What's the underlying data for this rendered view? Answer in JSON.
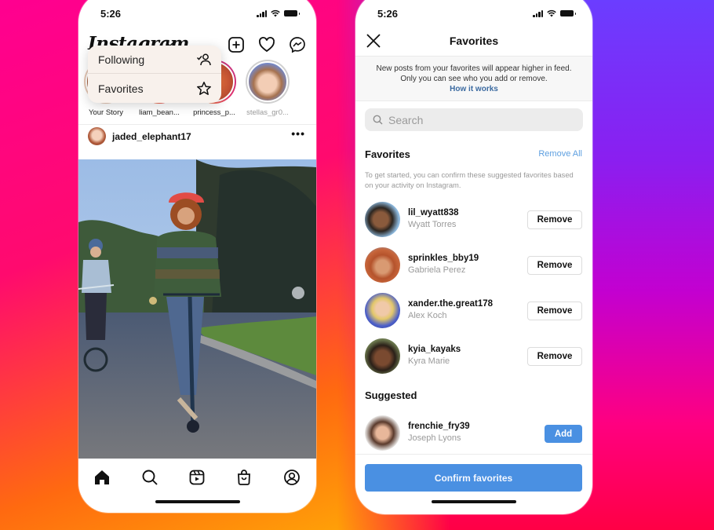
{
  "colors": {
    "accent_blue": "#4a90e2",
    "link_blue": "#3b6aa0",
    "remove_all_blue": "#5d9fe0",
    "muted_text": "#9a9a9a"
  },
  "left_phone": {
    "status_bar": {
      "time": "5:26",
      "icons": [
        "signal-icon",
        "wifi-icon",
        "battery-icon"
      ]
    },
    "header": {
      "logo": "Instagram",
      "logo_chevron": "⌄",
      "actions": [
        {
          "name": "new-post-icon"
        },
        {
          "name": "heart-icon"
        },
        {
          "name": "messenger-icon"
        }
      ]
    },
    "feed_menu": {
      "items": [
        {
          "label": "Following",
          "icon": "following-icon"
        },
        {
          "label": "Favorites",
          "icon": "star-icon"
        }
      ]
    },
    "stories": [
      {
        "label": "Your Story",
        "seen": false
      },
      {
        "label": "liam_bean...",
        "seen": false
      },
      {
        "label": "princess_p...",
        "seen": false
      },
      {
        "label": "stellas_gr0...",
        "seen": true
      }
    ],
    "post": {
      "username": "jaded_elephant17",
      "more": "•••",
      "image_alt": "Girl with red helmet riding a scooter on a street at dusk, cyclist behind"
    },
    "bottom_nav": [
      {
        "name": "home",
        "active": true
      },
      {
        "name": "search",
        "active": false
      },
      {
        "name": "reels",
        "active": false
      },
      {
        "name": "shop",
        "active": false
      },
      {
        "name": "profile",
        "active": false
      }
    ]
  },
  "right_phone": {
    "status_bar": {
      "time": "5:26"
    },
    "header": {
      "title": "Favorites"
    },
    "info": {
      "line1": "New posts from your favorites will appear higher in feed.",
      "line2": "Only you can see who you add or remove.",
      "link": "How it works"
    },
    "search": {
      "placeholder": "Search",
      "value": ""
    },
    "favorites_section": {
      "title": "Favorites",
      "remove_all": "Remove All",
      "helper": "To get started, you can confirm these suggested favorites based on your activity on Instagram.",
      "people": [
        {
          "username": "lil_wyatt838",
          "name": "Wyatt Torres",
          "action": "Remove"
        },
        {
          "username": "sprinkles_bby19",
          "name": "Gabriela Perez",
          "action": "Remove"
        },
        {
          "username": "xander.the.great178",
          "name": "Alex Koch",
          "action": "Remove"
        },
        {
          "username": "kyia_kayaks",
          "name": "Kyra Marie",
          "action": "Remove"
        }
      ]
    },
    "suggested_section": {
      "title": "Suggested",
      "people": [
        {
          "username": "frenchie_fry39",
          "name": "Joseph Lyons",
          "action": "Add"
        }
      ]
    },
    "confirm_button": "Confirm favorites"
  }
}
